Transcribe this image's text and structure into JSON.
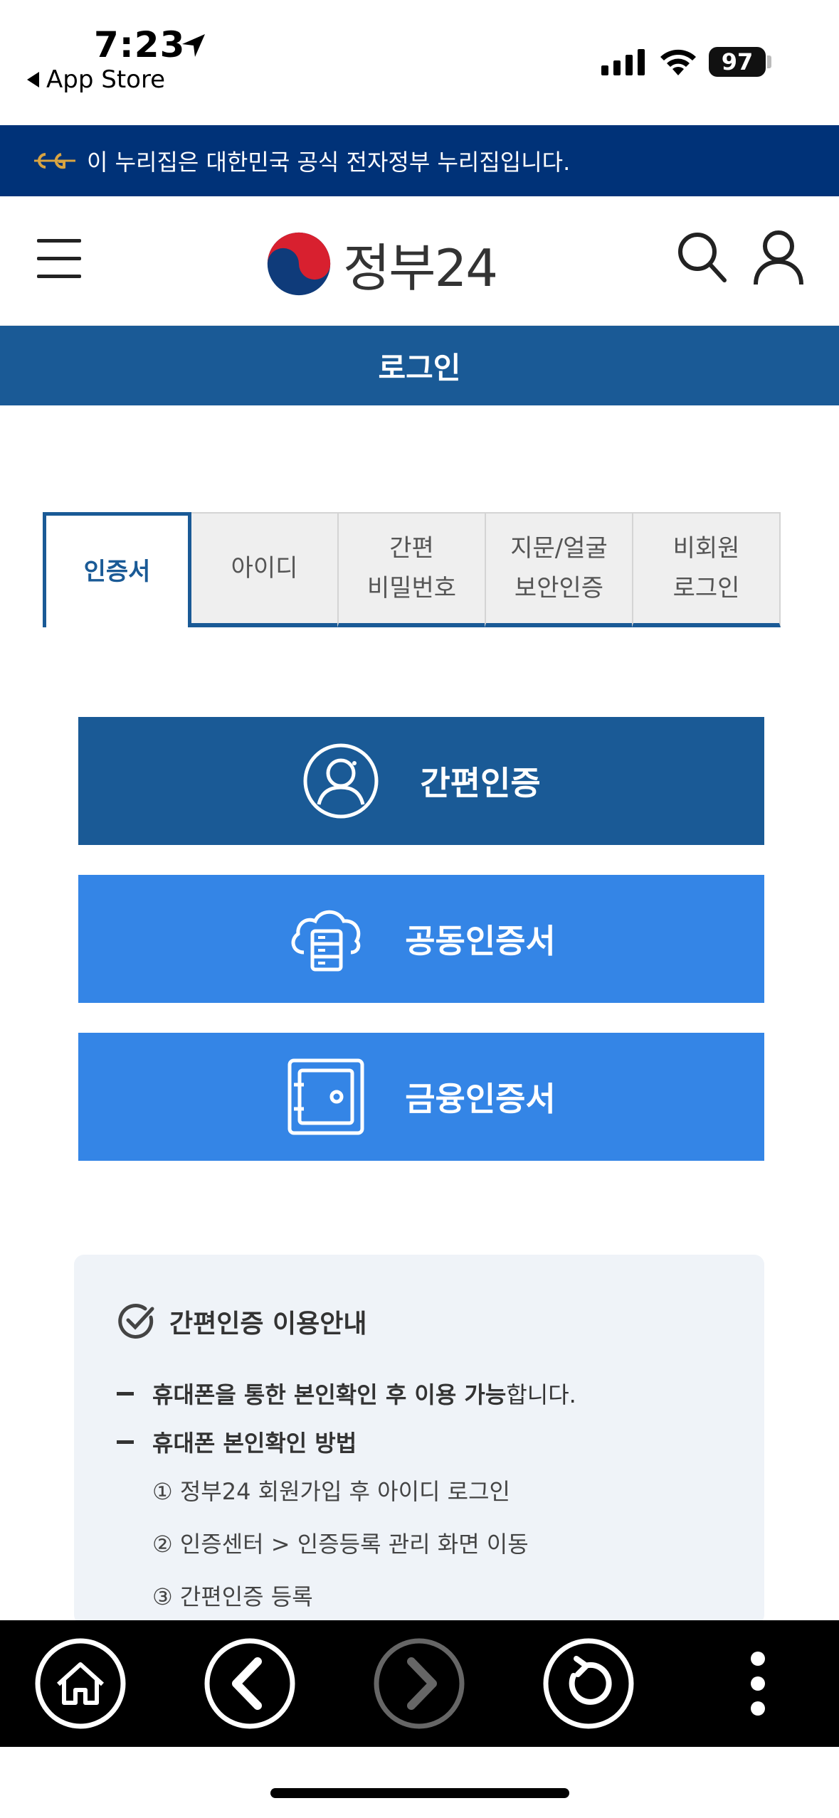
{
  "status_bar": {
    "time": "7:23",
    "back_app": "App Store",
    "battery": "97"
  },
  "gov_banner": {
    "text": "이 누리집은 대한민국 공식 전자정부 누리집입니다."
  },
  "header": {
    "logo_text": "정부24"
  },
  "page": {
    "title": "로그인"
  },
  "tabs": [
    {
      "label": "인증서",
      "active": true
    },
    {
      "label": "아이디",
      "active": false
    },
    {
      "label": "간편\n비밀번호",
      "active": false
    },
    {
      "label": "지문/얼굴\n보안인증",
      "active": false
    },
    {
      "label": "비회원\n로그인",
      "active": false
    }
  ],
  "auth_buttons": {
    "simple": "간편인증",
    "joint": "공동인증서",
    "finance": "금융인증서"
  },
  "info": {
    "title": "간편인증 이용안내",
    "item1_bold": "휴대폰을 통한 본인확인 후 이용 가능",
    "item1_rest": "합니다.",
    "item2_bold": "휴대폰 본인확인 방법",
    "steps": [
      "① 정부24 회원가입 후 아이디 로그인",
      "② 인증센터 > 인증등록 관리 화면 이동",
      "③ 간편인증 등록"
    ]
  },
  "colors": {
    "gov_banner_bg": "#003278",
    "primary_blue": "#1a5a96",
    "light_blue": "#3485e6",
    "info_bg": "#eff3f8"
  },
  "icons": {
    "menu": "hamburger-icon",
    "search": "search-icon",
    "user": "user-icon",
    "simple_auth": "person-circle-icon",
    "joint_cert": "cloud-server-icon",
    "finance_cert": "safe-icon",
    "home": "home-icon",
    "back": "chevron-left-icon",
    "forward": "chevron-right-icon",
    "reload": "reload-icon",
    "more": "more-vertical-icon"
  }
}
